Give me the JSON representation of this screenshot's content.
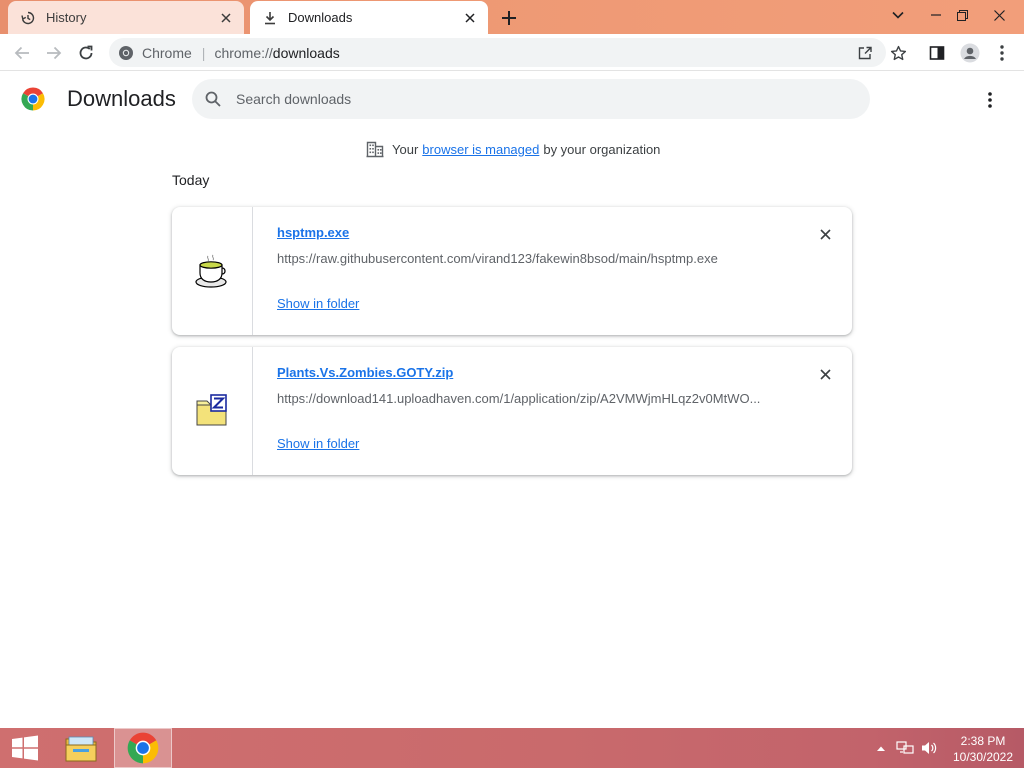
{
  "browser": {
    "tabs": [
      {
        "title": "History",
        "icon": "history-icon"
      },
      {
        "title": "Downloads",
        "icon": "download-icon",
        "active": true
      }
    ],
    "toolbar": {
      "site_name": "Chrome",
      "url_scheme": "chrome://",
      "url_host": "downloads"
    }
  },
  "page": {
    "title": "Downloads",
    "search_placeholder": "Search downloads",
    "managed_notice": {
      "prefix": "Your",
      "link": "browser is managed",
      "suffix": "by your organization"
    },
    "date_header": "Today",
    "downloads": [
      {
        "file_name": "hsptmp.exe",
        "url": "https://raw.githubusercontent.com/virand123/fakewin8bsod/main/hsptmp.exe",
        "action": "Show in folder",
        "icon": "java-cup-icon"
      },
      {
        "file_name": "Plants.Vs.Zombies.GOTY.zip",
        "url": "https://download141.uploadhaven.com/1/application/zip/A2VMWjmHLqz2v0MtWO...",
        "action": "Show in folder",
        "icon": "zip-folder-icon"
      }
    ]
  },
  "taskbar": {
    "time": "2:38 PM",
    "date": "10/30/2022"
  },
  "colors": {
    "accent_link": "#1a73e8",
    "tabstrip": "#ee9974",
    "taskbar": "#c96a6c"
  }
}
